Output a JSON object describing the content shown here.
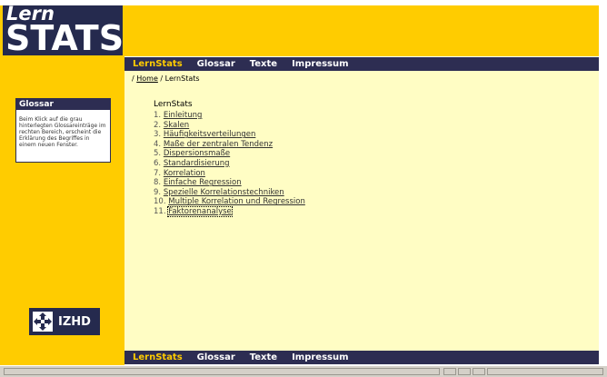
{
  "logo": {
    "line1": "Lern",
    "line2": "STATS"
  },
  "nav": [
    {
      "label": "LernStats",
      "active": true
    },
    {
      "label": "Glossar",
      "active": false
    },
    {
      "label": "Texte",
      "active": false
    },
    {
      "label": "Impressum",
      "active": false
    }
  ],
  "breadcrumb": {
    "prefix": "/ ",
    "home": "Home",
    "separator": " / ",
    "current": "LernStats"
  },
  "content": {
    "title": "LernStats",
    "items": [
      {
        "num": "1.",
        "label": "Einleitung"
      },
      {
        "num": "2.",
        "label": "Skalen"
      },
      {
        "num": "3.",
        "label": "Häufigkeitsverteilungen"
      },
      {
        "num": "4.",
        "label": "Maße der zentralen Tendenz"
      },
      {
        "num": "5.",
        "label": "Dispersionsmaße"
      },
      {
        "num": "6.",
        "label": "Standardisierung"
      },
      {
        "num": "7.",
        "label": "Korrelation"
      },
      {
        "num": "8.",
        "label": "Einfache Regression"
      },
      {
        "num": "9.",
        "label": "Spezielle Korrelationstechniken"
      },
      {
        "num": "10.",
        "label": "Multiple Korrelation und Regression"
      },
      {
        "num": "11.",
        "label": "Faktorenanalyse"
      }
    ]
  },
  "glossar_box": {
    "title": "Glossar",
    "text": "Beim Klick auf die grau hinterlegten Glossareinträge im rechten Bereich, erscheint die Erklärung des Begriffes in einem neuen Fenster."
  },
  "izhd_logo": {
    "label": "IZHD",
    "icon": "arrows-cross-icon"
  },
  "colors": {
    "yellow": "#ffcc00",
    "navy": "#2d2d52",
    "content_bg": "#fffdc4",
    "active_nav": "#ffcc00"
  }
}
